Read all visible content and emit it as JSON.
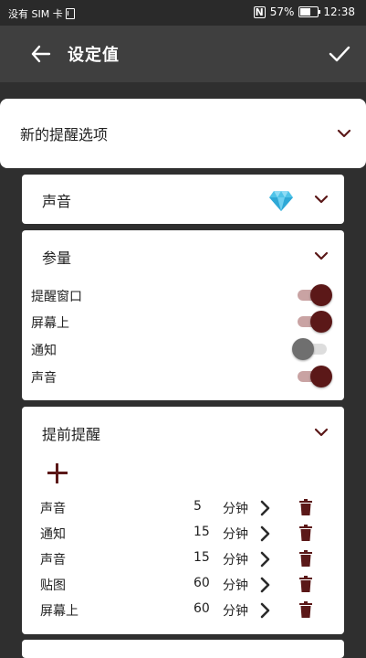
{
  "status_bar": {
    "carrier": "没有 SIM 卡",
    "battery": "57%",
    "battery_level": 0.57,
    "time": "12:38"
  },
  "app_bar": {
    "title": "设定值",
    "back_icon": "arrow-left-icon",
    "confirm_icon": "check-icon"
  },
  "reminder_options": {
    "title": "新的提醒选项"
  },
  "sound_card": {
    "title": "声音",
    "premium_icon": "diamond-icon"
  },
  "parameters": {
    "title": "参量",
    "items": [
      {
        "label": "提醒窗口",
        "on": true
      },
      {
        "label": "屏幕上",
        "on": true
      },
      {
        "label": "通知",
        "on": false
      },
      {
        "label": "声音",
        "on": true
      }
    ]
  },
  "advance": {
    "title": "提前提醒",
    "add_icon": "plus-icon",
    "rows": [
      {
        "type": "声音",
        "value": "5",
        "unit": "分钟"
      },
      {
        "type": "通知",
        "value": "15",
        "unit": "分钟"
      },
      {
        "type": "声音",
        "value": "15",
        "unit": "分钟"
      },
      {
        "type": "贴图",
        "value": "60",
        "unit": "分钟"
      },
      {
        "type": "屏幕上",
        "value": "60",
        "unit": "分钟"
      }
    ]
  },
  "colors": {
    "accent": "#5b1818",
    "track_on": "#c9a3a3",
    "knob_off": "#6f6f6f",
    "track_off": "#dddddd",
    "gem": "#4fc3e8"
  }
}
